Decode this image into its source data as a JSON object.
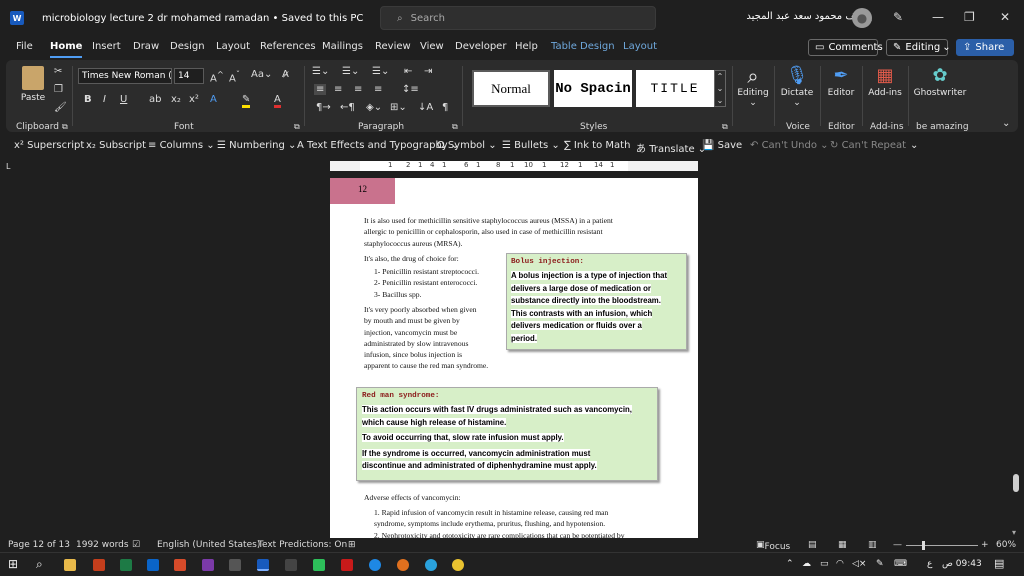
{
  "window": {
    "title": "microbiology lecture 2 dr mohamed ramadan  •  Saved to this PC",
    "search_placeholder": "Search",
    "user_name": "يوسف محمود سعد عبد المجيد"
  },
  "menu": {
    "tabs": [
      "File",
      "Home",
      "Insert",
      "Draw",
      "Design",
      "Layout",
      "References",
      "Mailings",
      "Review",
      "View",
      "Developer",
      "Help",
      "Table Design",
      "Layout"
    ],
    "comments": "Comments",
    "editing": "Editing",
    "share": "Share"
  },
  "ribbon": {
    "paste": "Paste",
    "font_name": "Times New Roman (",
    "font_size": "14",
    "styles": [
      "Normal",
      "No Spacin",
      "TITLE"
    ],
    "editing": "Editing",
    "dictate": "Dictate",
    "editor": "Editor",
    "addins": "Add-ins",
    "ghostwriter": "Ghostwriter",
    "groups": [
      "Clipboard",
      "Font",
      "Paragraph",
      "Styles",
      "Voice",
      "Editor",
      "Add-ins",
      "be amazing"
    ]
  },
  "quick": [
    "Superscript",
    "Subscript",
    "Columns",
    "Numbering",
    "Text Effects and Typography",
    "Symbol",
    "Bullets",
    "Ink to Math",
    "Translate",
    "Save",
    "Can't Undo",
    "Can't Repeat"
  ],
  "ruler": [
    "1",
    "2",
    "1",
    "4",
    "1",
    "6",
    "1",
    "8",
    "1",
    "10",
    "1",
    "12",
    "1",
    "14",
    "1"
  ],
  "document": {
    "page_number": "12",
    "para1": [
      "It is also used for methicillin sensitive staphylococcus aureus (MSSA) in a patient",
      "allergic to penicillin or cephalosporin, also used in case of methicillin resistant",
      "staphylococcus aureus (MRSA)."
    ],
    "drug_intro": "It's also, the drug of choice for:",
    "drug_list": [
      "1-  Penicillin resistant streptococci.",
      "2-  Penicillin resistant enterococci.",
      "3-  Bacillus spp."
    ],
    "para2": [
      "It's very poorly absorbed when given",
      "by mouth and must be given by",
      "injection, vancomycin must be",
      "administrated by slow intravenous",
      "infusion, since bolus injection is",
      "apparent to cause the red man syndrome."
    ],
    "bolus_head": "Bolus injection:",
    "bolus_lines": [
      "A bolus injection is a type of injection that",
      "delivers a large dose of medication or",
      "substance directly into the bloodstream.",
      "This contrasts with an infusion, which",
      "delivers medication or fluids over a",
      "period."
    ],
    "redman_head": "Red man syndrome:",
    "redman_lines": [
      "This action occurs with fast IV drugs administrated such as vancomycin,",
      "which cause high release of histamine.",
      "To avoid occurring that, slow rate infusion must apply.",
      "If the syndrome is occurred, vancomycin administration must",
      "discontinue and administrated of diphenhydramine must apply."
    ],
    "adverse_head": "Adverse effects of vancomycin:",
    "adverse": [
      "1.   Rapid infusion of vancomycin result in histamine release, causing red man",
      "      syndrome, symptoms include erythema, pruritus, flushing, and hypotension.",
      "2.   Nephrotoxicity and ototoxicity are rare complications that can be potentiated by"
    ]
  },
  "status": {
    "page": "Page 12 of 13",
    "words": "1992 words",
    "language": "English (United States)",
    "predictions": "Text Predictions: On",
    "focus": "Focus",
    "zoom": "60%"
  },
  "tray": {
    "lang": "ع",
    "time": "09:43 ص"
  },
  "colors": {
    "accent": "#4f9cf2",
    "page_num_bg": "#c9728d",
    "box_bg": "#d7efc8",
    "box_head": "#8b1a1a"
  }
}
